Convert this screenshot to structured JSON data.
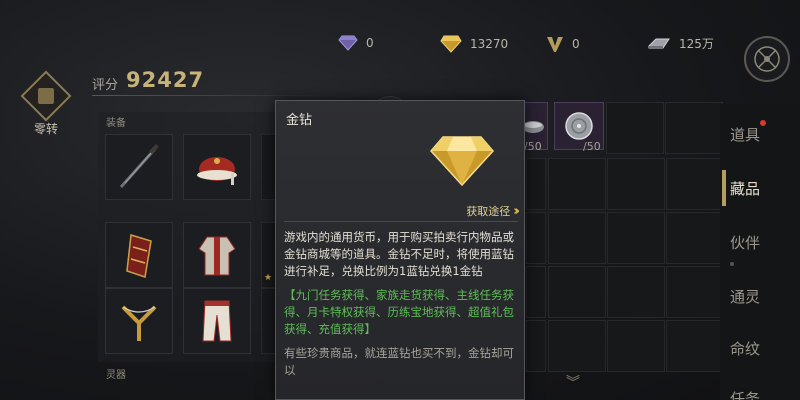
{
  "currencies": [
    {
      "name": "purple-diamond",
      "value": "0",
      "color": "#7d6fb8"
    },
    {
      "name": "gold-diamond",
      "value": "13270",
      "color": "#d7b148"
    },
    {
      "name": "v-token",
      "value": "0",
      "color": "#b9a36a"
    },
    {
      "name": "silver-ingot",
      "value": "125万",
      "color": "#aeb0b5"
    }
  ],
  "left": {
    "reform_label": "零转",
    "score_label": "评分",
    "score_value": "92427",
    "equip_label": "装备",
    "spirit_label": "灵器"
  },
  "grid": {
    "count_1": "/50",
    "count_2": "/50"
  },
  "tabs": [
    {
      "label": "道具",
      "active": false,
      "badge": true
    },
    {
      "label": "藏品",
      "active": true,
      "badge": false
    },
    {
      "label": "伙伴",
      "active": false,
      "badge": false
    },
    {
      "label": "通灵",
      "active": false,
      "badge": false
    },
    {
      "label": "命纹",
      "active": false,
      "badge": false
    },
    {
      "label": "任务",
      "active": false,
      "badge": false
    }
  ],
  "popup": {
    "title": "金钻",
    "source_label": "获取途径",
    "description": "游戏内的通用货币，用于购买拍卖行内物品或金钻商城等的道具。金钻不足时，将使用蓝钻进行补足，兑换比例为1蓝钻兑换1金钻",
    "acquire": "【九门任务获得、家族走货获得、主线任务获得、月卡特权获得、历练宝地获得、超值礼包获得、充值获得】",
    "note": "有些珍贵商品，就连蓝钻也买不到，金钻却可以"
  },
  "colors": {
    "gold_accent": "#c7b27a",
    "acquire_green": "#5fbe57",
    "badge_red": "#d63a2a"
  }
}
